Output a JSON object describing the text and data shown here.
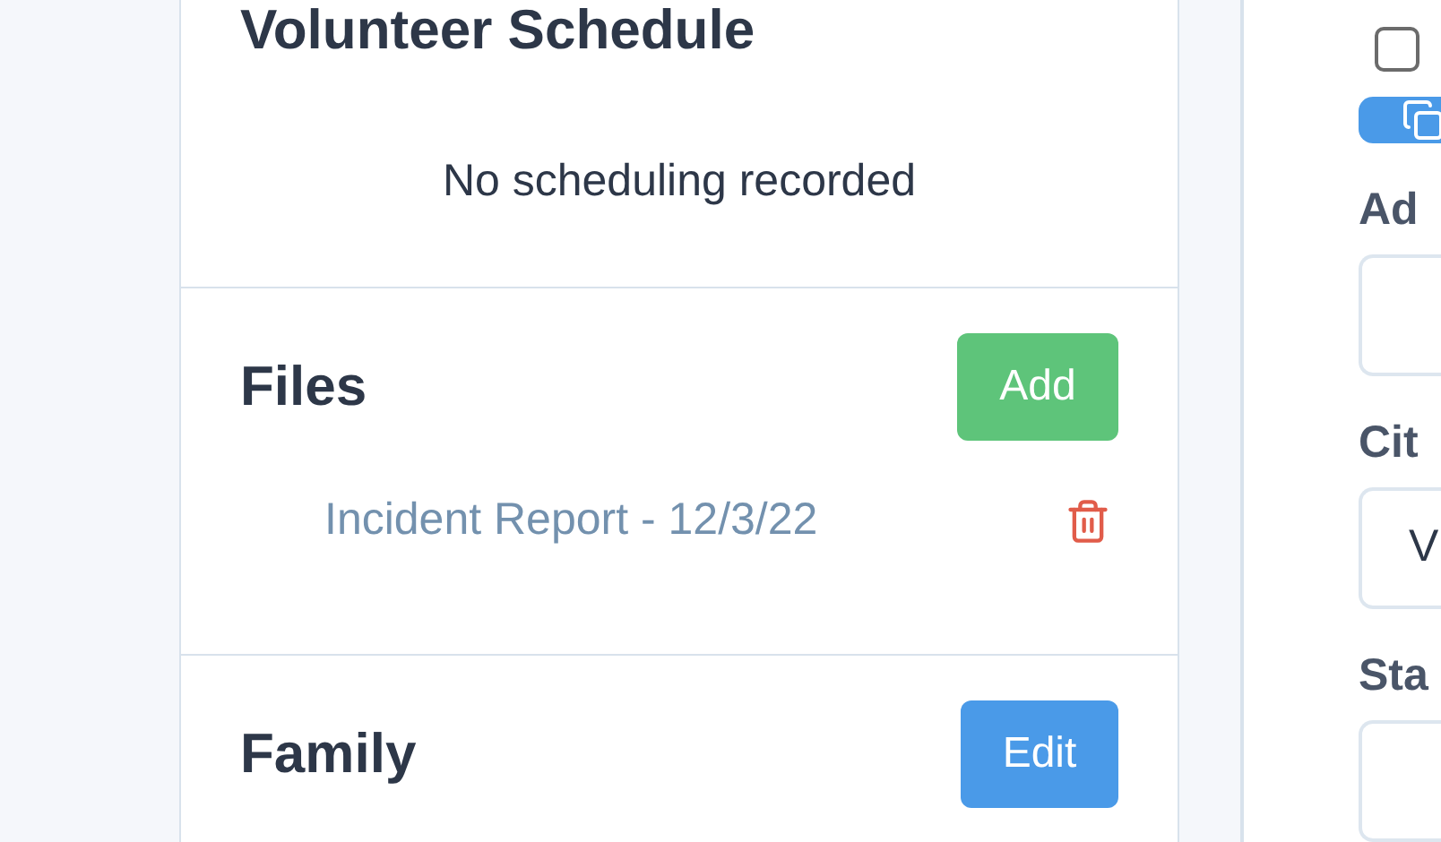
{
  "schedule": {
    "title": "Volunteer Schedule",
    "empty_text": "No scheduling recorded"
  },
  "files": {
    "title": "Files",
    "add_button": "Add",
    "items": [
      {
        "name": "Incident Report - 12/3/22"
      }
    ]
  },
  "family": {
    "title": "Family",
    "edit_button": "Edit"
  },
  "side_panel": {
    "checkbox": {
      "checked": false
    },
    "fields": [
      {
        "label": "Ad"
      },
      {
        "label": "Cit",
        "value": "V"
      },
      {
        "label": "Sta"
      }
    ]
  }
}
